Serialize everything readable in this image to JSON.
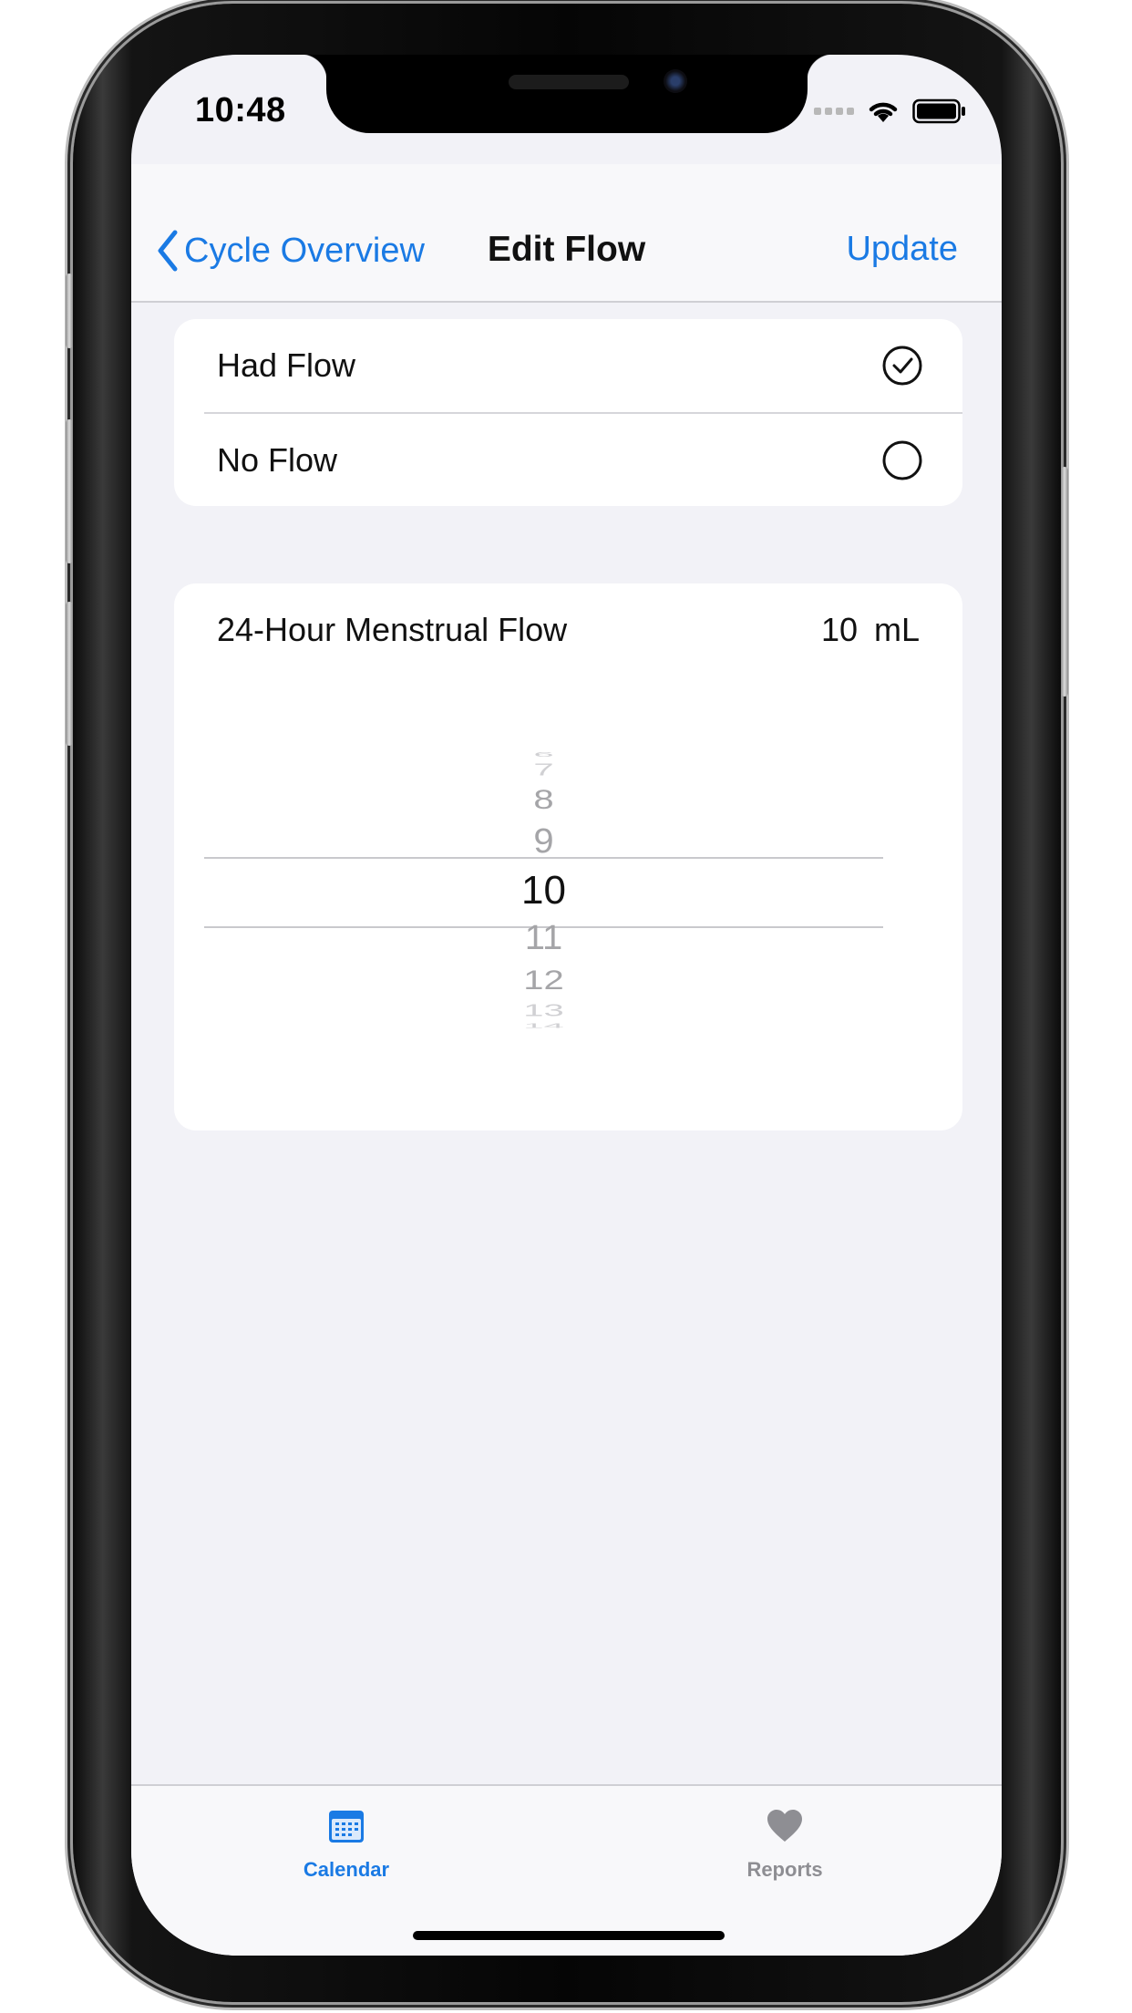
{
  "status_bar": {
    "time": "10:48",
    "icons": [
      "cellular-signal-icon",
      "wifi-icon",
      "battery-icon"
    ]
  },
  "nav": {
    "back_label": "Cycle Overview",
    "title": "Edit Flow",
    "action_label": "Update",
    "accent_color": "#1a7ae4"
  },
  "flow_options": [
    {
      "label": "Had Flow",
      "selected": true
    },
    {
      "label": "No Flow",
      "selected": false
    }
  ],
  "flow_amount": {
    "title": "24-Hour Menstrual Flow",
    "value": "10",
    "unit": "mL",
    "picker_numbers": [
      "6",
      "7",
      "8",
      "9",
      "10",
      "11",
      "12",
      "13",
      "14"
    ],
    "selected_value": "10"
  },
  "tabs": [
    {
      "label": "Calendar",
      "icon": "calendar-icon",
      "active": true,
      "color": "#1a7ae4"
    },
    {
      "label": "Reports",
      "icon": "heart-icon",
      "active": false,
      "color": "#8e8e93"
    }
  ]
}
